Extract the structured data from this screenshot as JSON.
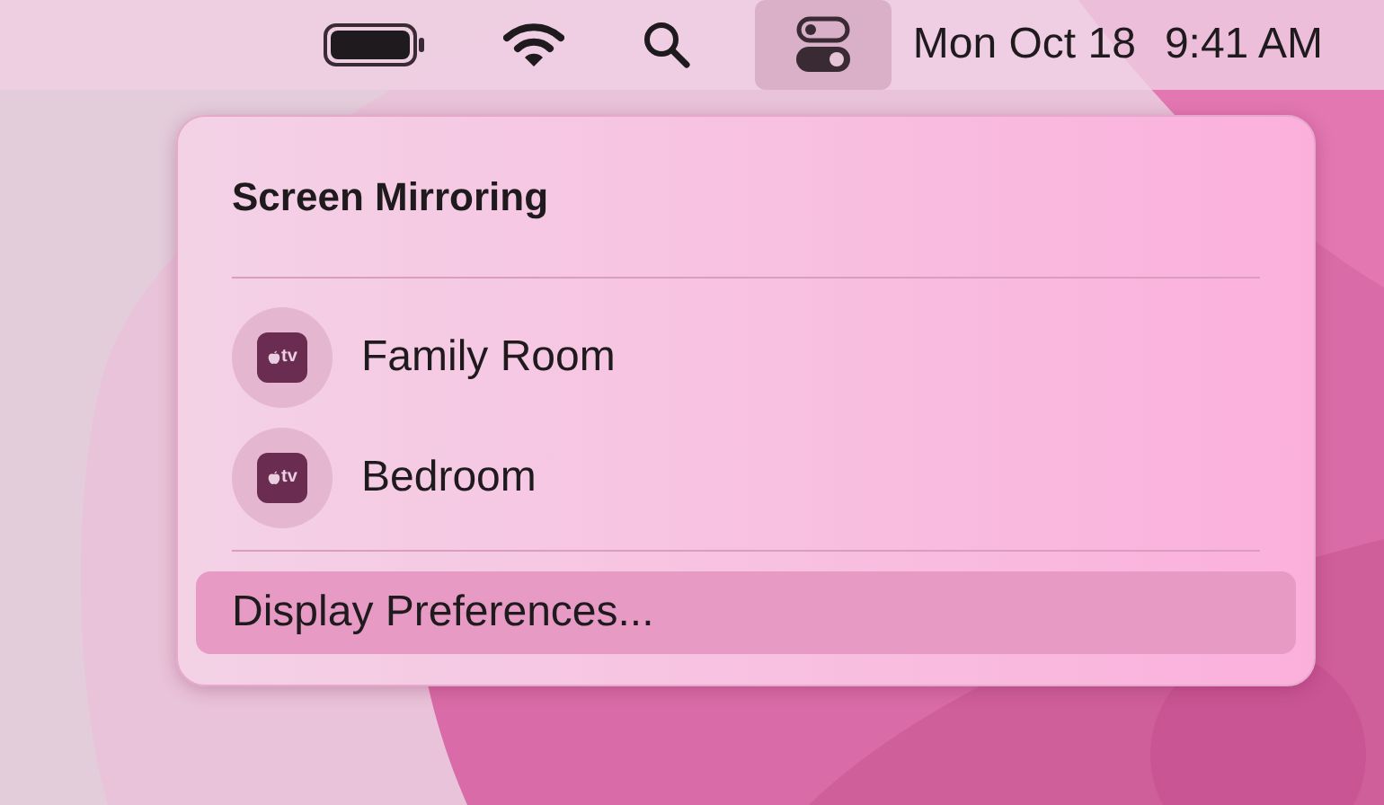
{
  "menu_bar": {
    "items": [
      {
        "kind": "battery",
        "selected": false
      },
      {
        "kind": "wifi",
        "selected": false
      },
      {
        "kind": "search",
        "selected": false
      },
      {
        "kind": "control_center",
        "selected": true
      }
    ],
    "date": "Mon Oct 18",
    "time": "9:41 AM"
  },
  "panel": {
    "title": "Screen Mirroring",
    "devices": [
      {
        "label": "Family Room",
        "badge": "tv"
      },
      {
        "label": "Bedroom",
        "badge": "tv"
      }
    ],
    "footer": {
      "label": "Display Preferences...",
      "highlighted": true
    }
  }
}
